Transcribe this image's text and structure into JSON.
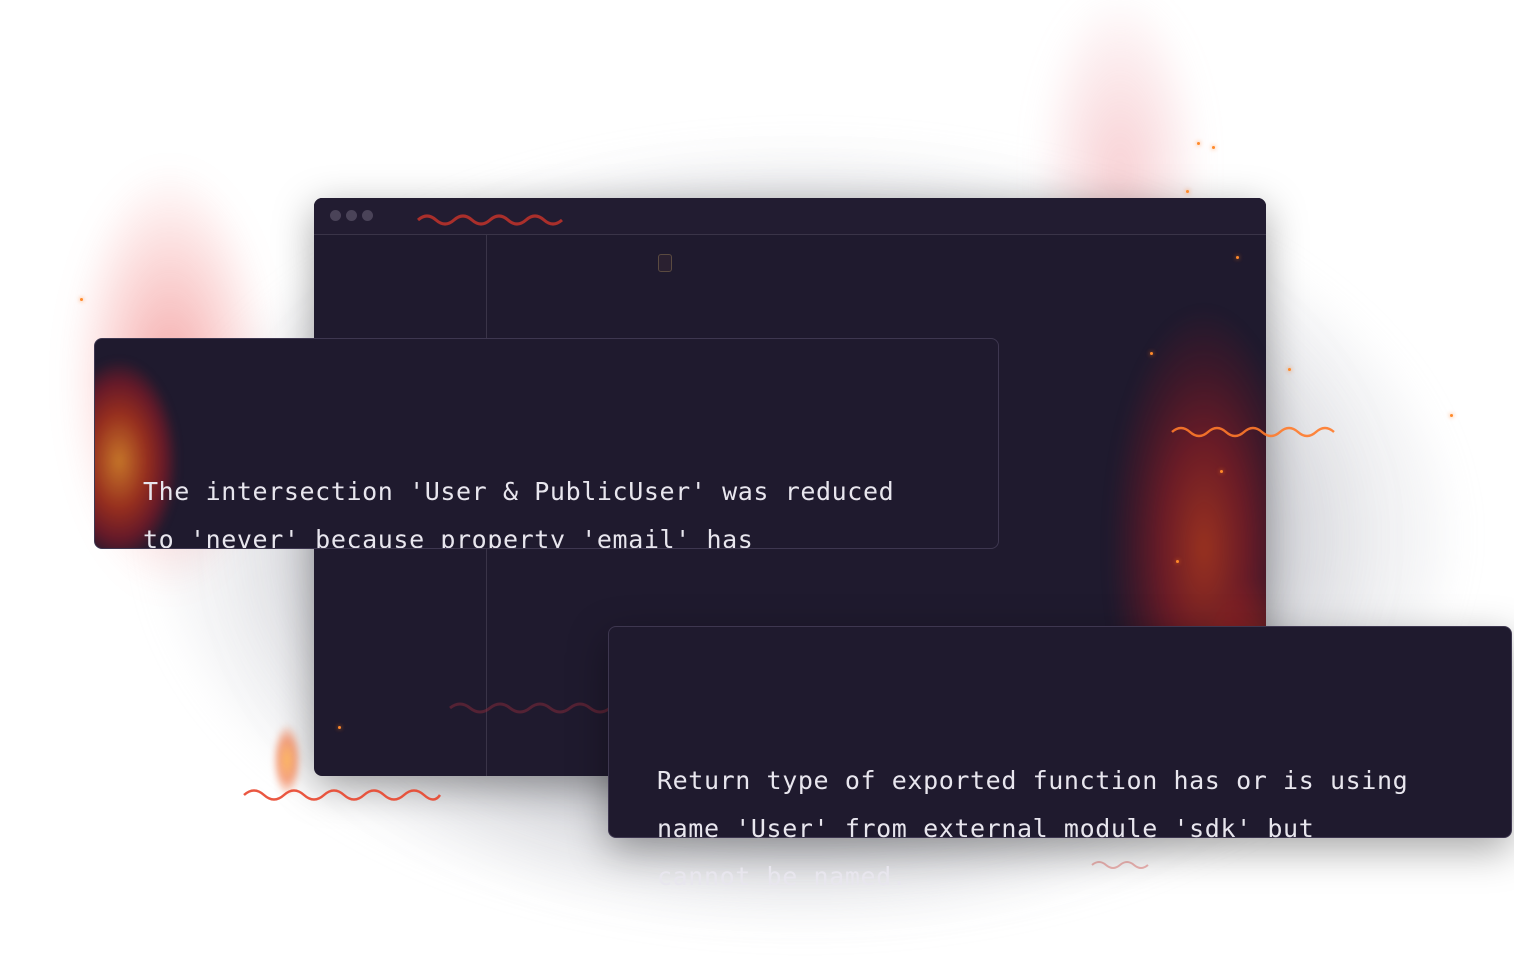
{
  "window": {
    "controls": [
      "close",
      "minimize",
      "maximize"
    ],
    "icons": [
      "window-dot-icon",
      "file-icon",
      "squiggle-underline-icon"
    ]
  },
  "errors": [
    {
      "message": "The intersection 'User & PublicUser' was reduced\nto 'never' because property 'email' has\nconflicting types in some constituents."
    },
    {
      "message": "Return type of exported function has or is using\nname 'User' from external module 'sdk' but\ncannot be named."
    }
  ],
  "colors": {
    "background": "#ffffff",
    "window_bg": "#1f1a2e",
    "popup_border": "#3e3750",
    "text": "#e8e6ee",
    "error_squiggle": "#e8452c",
    "fire_orange": "#ff8a2a",
    "fire_red": "#c8202a"
  }
}
